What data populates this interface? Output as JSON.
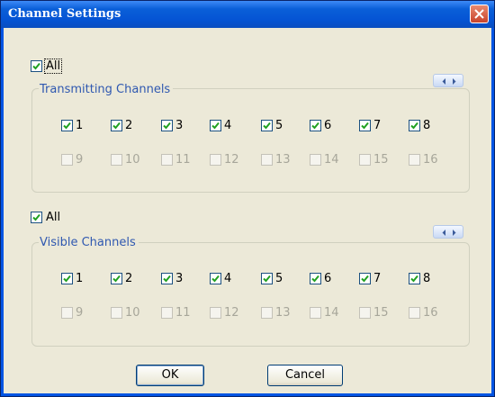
{
  "window": {
    "title": "Channel Settings"
  },
  "transmitting": {
    "all_label": "All",
    "all_checked": true,
    "group_label": "Transmitting Channels",
    "channels": [
      {
        "n": "1",
        "checked": true,
        "enabled": true
      },
      {
        "n": "2",
        "checked": true,
        "enabled": true
      },
      {
        "n": "3",
        "checked": true,
        "enabled": true
      },
      {
        "n": "4",
        "checked": true,
        "enabled": true
      },
      {
        "n": "5",
        "checked": true,
        "enabled": true
      },
      {
        "n": "6",
        "checked": true,
        "enabled": true
      },
      {
        "n": "7",
        "checked": true,
        "enabled": true
      },
      {
        "n": "8",
        "checked": true,
        "enabled": true
      },
      {
        "n": "9",
        "checked": false,
        "enabled": false
      },
      {
        "n": "10",
        "checked": false,
        "enabled": false
      },
      {
        "n": "11",
        "checked": false,
        "enabled": false
      },
      {
        "n": "12",
        "checked": false,
        "enabled": false
      },
      {
        "n": "13",
        "checked": false,
        "enabled": false
      },
      {
        "n": "14",
        "checked": false,
        "enabled": false
      },
      {
        "n": "15",
        "checked": false,
        "enabled": false
      },
      {
        "n": "16",
        "checked": false,
        "enabled": false
      }
    ]
  },
  "visible": {
    "all_label": "All",
    "all_checked": true,
    "group_label": "Visible Channels",
    "channels": [
      {
        "n": "1",
        "checked": true,
        "enabled": true
      },
      {
        "n": "2",
        "checked": true,
        "enabled": true
      },
      {
        "n": "3",
        "checked": true,
        "enabled": true
      },
      {
        "n": "4",
        "checked": true,
        "enabled": true
      },
      {
        "n": "5",
        "checked": true,
        "enabled": true
      },
      {
        "n": "6",
        "checked": true,
        "enabled": true
      },
      {
        "n": "7",
        "checked": true,
        "enabled": true
      },
      {
        "n": "8",
        "checked": true,
        "enabled": true
      },
      {
        "n": "9",
        "checked": false,
        "enabled": false
      },
      {
        "n": "10",
        "checked": false,
        "enabled": false
      },
      {
        "n": "11",
        "checked": false,
        "enabled": false
      },
      {
        "n": "12",
        "checked": false,
        "enabled": false
      },
      {
        "n": "13",
        "checked": false,
        "enabled": false
      },
      {
        "n": "14",
        "checked": false,
        "enabled": false
      },
      {
        "n": "15",
        "checked": false,
        "enabled": false
      },
      {
        "n": "16",
        "checked": false,
        "enabled": false
      }
    ]
  },
  "buttons": {
    "ok": "OK",
    "cancel": "Cancel"
  },
  "icons": {
    "close": "close-icon",
    "nav": "left-right-arrows-icon",
    "check": "checkmark-icon"
  },
  "colors": {
    "title_bar": "#0554d4",
    "group_label": "#2f58b0",
    "check": "#21a121",
    "dialog_bg": "#ece9d8"
  }
}
